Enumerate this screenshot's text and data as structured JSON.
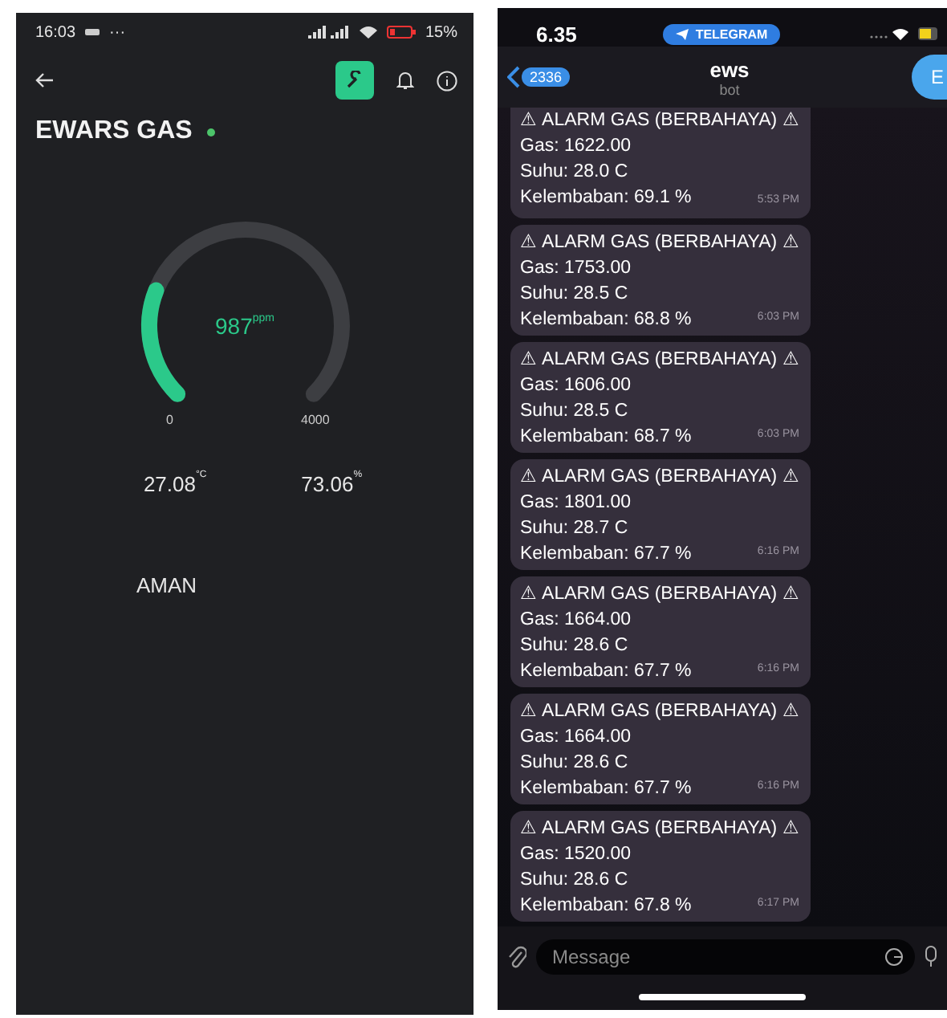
{
  "app_screen": {
    "status_bar": {
      "time": "16:03",
      "dots": "···",
      "battery": "15%"
    },
    "title": "EWARS GAS",
    "online": true,
    "gauge": {
      "value": "987",
      "unit": "ppm",
      "level": 0.247,
      "min": "0",
      "max": "4000"
    },
    "temperature": {
      "value": "27.08",
      "unit": "°C"
    },
    "humidity": {
      "value": "73.06",
      "unit": "%"
    },
    "status": "AMAN"
  },
  "chat_screen": {
    "status_bar": {
      "time": "6.35",
      "app_pill": "TELEGRAM"
    },
    "back_badge": "2336",
    "chat_title": "ews",
    "chat_subtitle": "bot",
    "avatar_letter": "E",
    "messages": [
      {
        "lines": [
          "⚠ ALARM GAS (BERBAHAYA) ⚠",
          "Gas: 1622.00",
          "Suhu: 28.0 C",
          "Kelembaban: 69.1 %"
        ],
        "time": "5:53 PM"
      },
      {
        "lines": [
          "⚠ ALARM GAS (BERBAHAYA) ⚠",
          "Gas: 1753.00",
          "Suhu: 28.5 C",
          "Kelembaban: 68.8 %"
        ],
        "time": "6:03 PM"
      },
      {
        "lines": [
          "⚠ ALARM GAS (BERBAHAYA) ⚠",
          "Gas: 1606.00",
          "Suhu: 28.5 C",
          "Kelembaban: 68.7 %"
        ],
        "time": "6:03 PM"
      },
      {
        "lines": [
          "⚠ ALARM GAS (BERBAHAYA) ⚠",
          "Gas: 1801.00",
          "Suhu: 28.7 C",
          "Kelembaban: 67.7 %"
        ],
        "time": "6:16 PM"
      },
      {
        "lines": [
          "⚠ ALARM GAS (BERBAHAYA) ⚠",
          "Gas: 1664.00",
          "Suhu: 28.6 C",
          "Kelembaban: 67.7 %"
        ],
        "time": "6:16 PM"
      },
      {
        "lines": [
          "⚠ ALARM GAS (BERBAHAYA) ⚠",
          "Gas: 1664.00",
          "Suhu: 28.6 C",
          "Kelembaban: 67.7 %"
        ],
        "time": "6:16 PM"
      },
      {
        "lines": [
          "⚠ ALARM GAS (BERBAHAYA) ⚠",
          "Gas: 1520.00",
          "Suhu: 28.6 C",
          "Kelembaban: 67.8 %"
        ],
        "time": "6:17 PM"
      }
    ],
    "input": {
      "placeholder": "Message"
    }
  }
}
